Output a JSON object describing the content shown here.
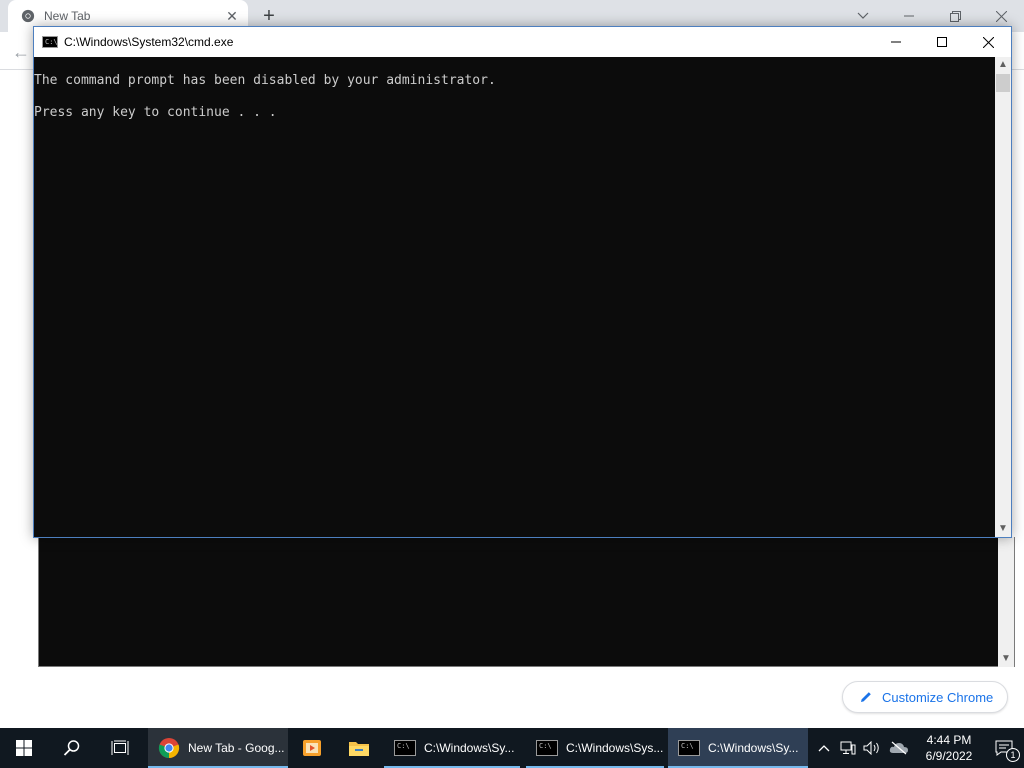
{
  "chrome": {
    "tab_title": "New Tab",
    "customize_label": "Customize Chrome"
  },
  "cmd": {
    "title": "C:\\Windows\\System32\\cmd.exe",
    "icon_text": "C:\\",
    "lines": [
      "The command prompt has been disabled by your administrator.",
      "Press any key to continue . . ."
    ]
  },
  "taskbar": {
    "apps": [
      {
        "label": "New Tab - Goog...",
        "icon": "chrome-icon"
      },
      {
        "label": "",
        "icon": "media-player-icon"
      },
      {
        "label": "",
        "icon": "file-explorer-icon"
      },
      {
        "label": "C:\\Windows\\Sy...",
        "icon": "cmd-icon"
      },
      {
        "label": "C:\\Windows\\Sys...",
        "icon": "cmd-icon"
      },
      {
        "label": "C:\\Windows\\Sy...",
        "icon": "cmd-icon"
      }
    ],
    "time": "4:44 PM",
    "date": "6/9/2022",
    "notification_count": "1"
  },
  "colors": {
    "console_bg": "#0c0c0c",
    "console_text": "#cccccc",
    "taskbar_bg": "#101820",
    "accent": "#1a73e8"
  }
}
